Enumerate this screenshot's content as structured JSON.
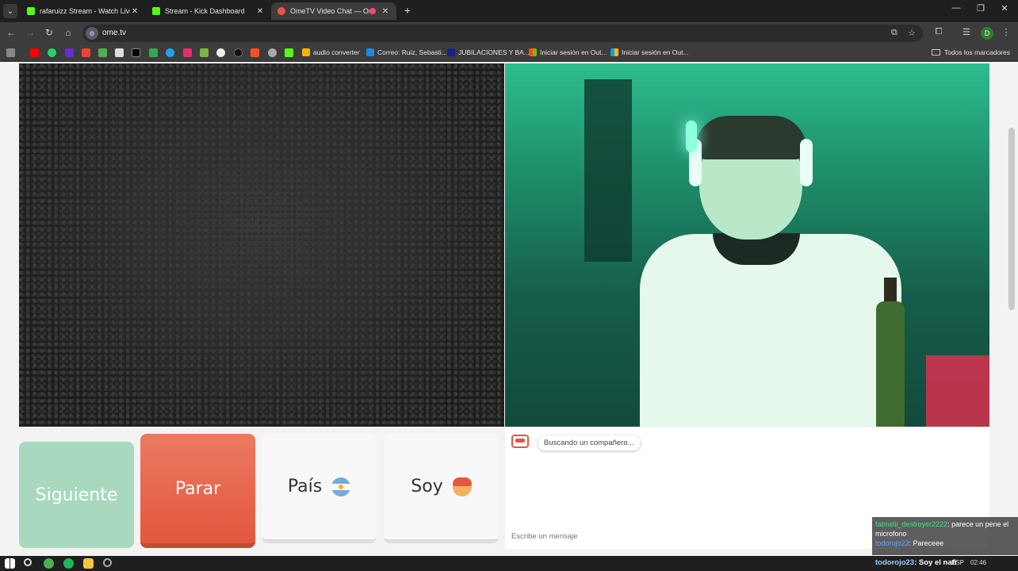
{
  "tabs": [
    {
      "title": "rafaruizz Stream - Watch Live o"
    },
    {
      "title": "Stream - Kick Dashboard"
    },
    {
      "title": "OmeTV Video Chat — Ome"
    }
  ],
  "address": {
    "url": "ome.tv"
  },
  "bookmarks": [
    {
      "label": "audio converter"
    },
    {
      "label": "Correo: Ruiz, Sebasti..."
    },
    {
      "label": "JUBILACIONES Y BA..."
    },
    {
      "label": "Iniciar sesión en Out..."
    },
    {
      "label": "Iniciar sesión en Out..."
    }
  ],
  "all_bookmarks_label": "Todos los marcadores",
  "profile_initial": "D",
  "buttons": {
    "next": "Siguiente",
    "stop": "Parar",
    "country": "País",
    "gender": "Soy"
  },
  "chat": {
    "status": "Buscando un compañero...",
    "input_placeholder": "Escribe un mensaje"
  },
  "overlay": {
    "line1_user": "fatmelii_destroyer2222",
    "line1_text": ": parece un pene el microfono",
    "line2_user": "todorojo23",
    "line2_text": ": Pareceee",
    "line3_user": "todorojo23",
    "line3_text": ": Soy el nafi"
  },
  "taskbar": {
    "lang": "ESP",
    "time": "02:46"
  },
  "colors": {
    "stop_button": "#e2573f",
    "next_button": "#a8d9bf",
    "kick_green": "#53fc18"
  }
}
